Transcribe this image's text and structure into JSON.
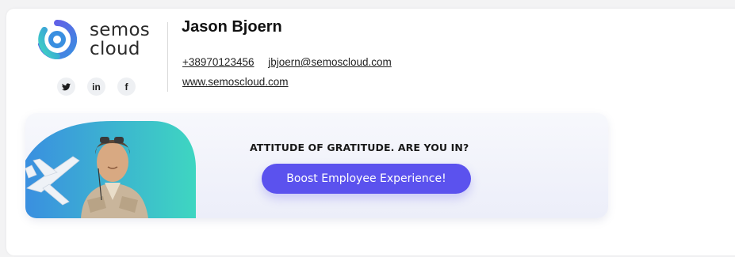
{
  "brand": {
    "line1": "semos",
    "line2": "cloud",
    "logo_icon": "semos-swirl-icon",
    "colors": {
      "blue": "#3a8fe0",
      "teal": "#3ed6c1",
      "purple": "#6b54e8"
    }
  },
  "social": [
    {
      "icon": "twitter-icon",
      "glyph": " "
    },
    {
      "icon": "linkedin-icon",
      "glyph": "in"
    },
    {
      "icon": "facebook-icon",
      "glyph": "f"
    }
  ],
  "person": {
    "name": "Jason Bjoern",
    "phone": "+38970123456",
    "email": "jbjoern@semoscloud.com",
    "website": "www.semoscloud.com"
  },
  "banner": {
    "tagline": "ATTITUDE OF GRATITUDE. ARE YOU IN?",
    "cta_label": "Boost Employee Experience!",
    "cta_color": "#5b52ee"
  }
}
